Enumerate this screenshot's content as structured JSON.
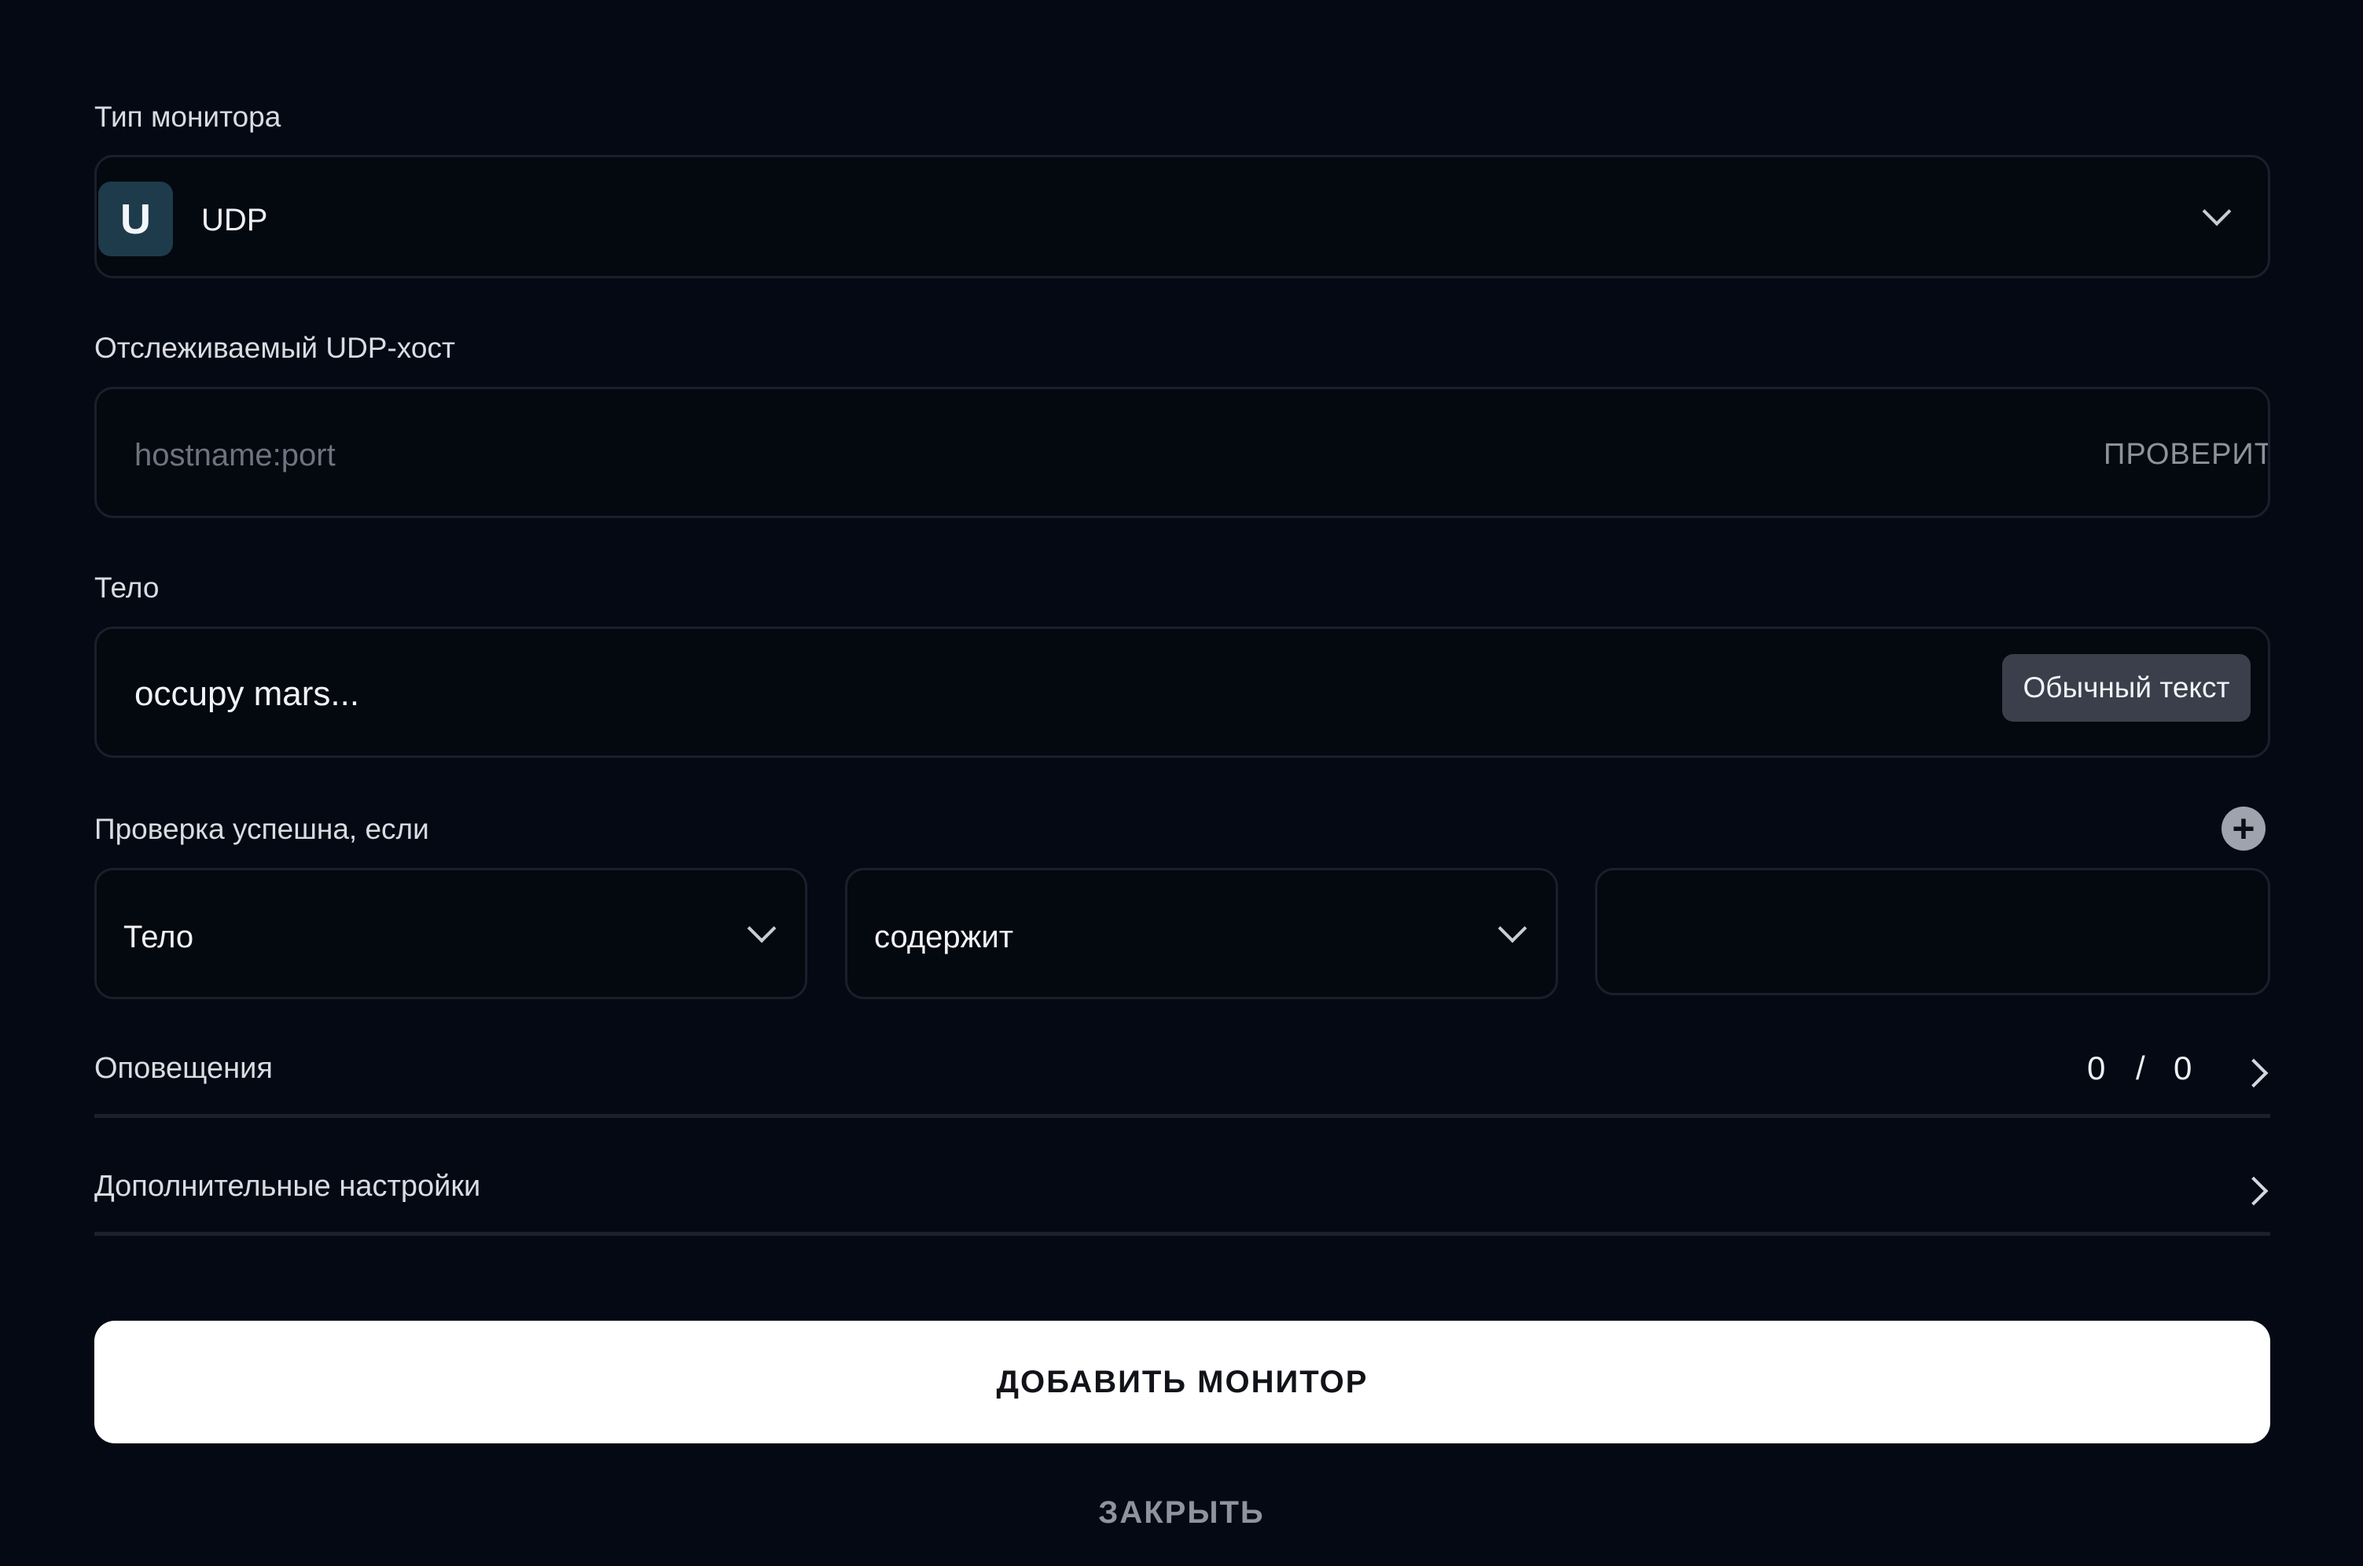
{
  "monitor_type": {
    "label": "Тип монитора",
    "badge_letter": "U",
    "value": "UDP",
    "badge_color": "#1d3b4a"
  },
  "host": {
    "label": "Отслеживаемый UDP-хост",
    "placeholder": "hostname:port",
    "check_label": "ПРОВЕРИТЬ"
  },
  "body": {
    "label": "Тело",
    "value": "occupy mars...",
    "format_chip": "Обычный текст"
  },
  "condition": {
    "label": "Проверка успешна, если",
    "add_symbol": "+",
    "field_value": "Тело",
    "operator_value": "содержит",
    "match_value": ""
  },
  "notifications": {
    "label": "Оповещения",
    "enabled": "0",
    "separator": "/",
    "total": "0"
  },
  "advanced": {
    "label": "Дополнительные настройки"
  },
  "actions": {
    "submit_label": "ДОБАВИТЬ МОНИТОР",
    "close_label": "ЗАКРЫТЬ"
  },
  "colors": {
    "background": "#050914",
    "input_border": "#1a1f2c",
    "primary_button": "#ffffff"
  }
}
